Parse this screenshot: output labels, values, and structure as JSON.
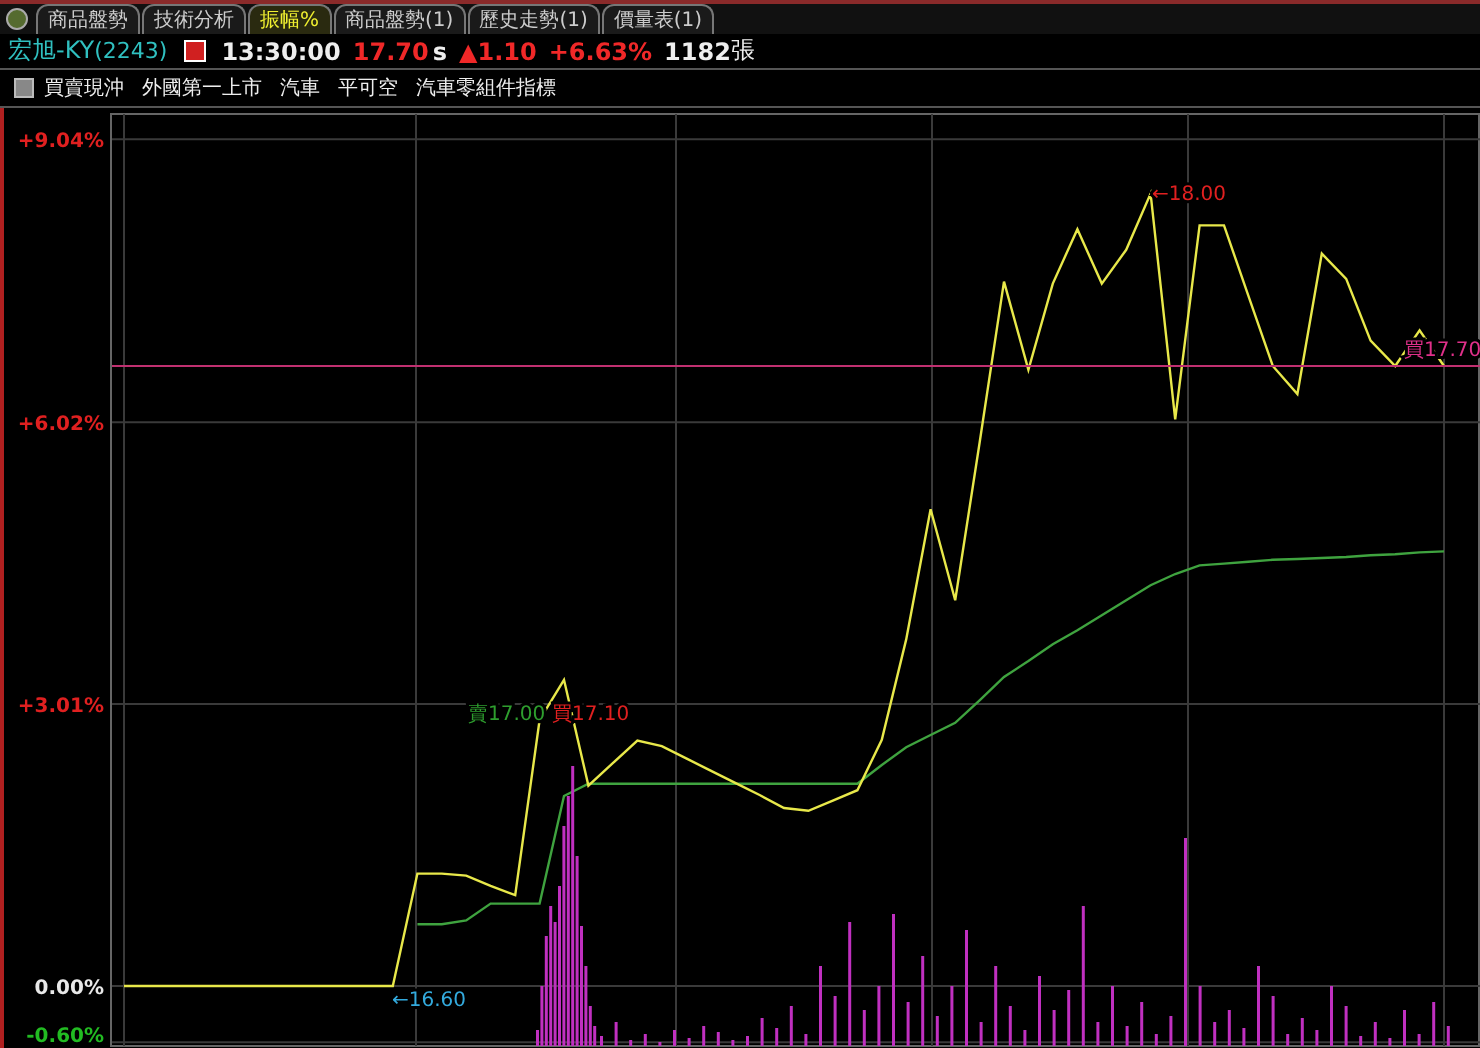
{
  "tabs": [
    {
      "label": "商品盤勢",
      "selected": false
    },
    {
      "label": "技術分析",
      "selected": false
    },
    {
      "label": "振幅%",
      "selected": true
    },
    {
      "label": "商品盤勢(1)",
      "selected": false
    },
    {
      "label": "歷史走勢(1)",
      "selected": false
    },
    {
      "label": "價量表(1)",
      "selected": false
    }
  ],
  "quote": {
    "name": "宏旭-KY",
    "code": "(2243)",
    "time": "13:30:00",
    "price": "17.70",
    "price_flag": "s",
    "change": "▲1.10",
    "change_pct": "+6.63%",
    "volume": "1182",
    "volume_unit": "張"
  },
  "tags": [
    "買賣現沖",
    "外國第一上市",
    "汽車",
    "平可空",
    "汽車零組件指標"
  ],
  "chart": {
    "chart_data": {
      "type": "line",
      "ylim": [
        -0.64,
        9.31
      ],
      "grid": true,
      "categories": [
        null,
        null,
        null,
        null,
        null,
        null,
        null,
        null,
        null,
        null,
        null,
        null,
        null,
        null,
        null,
        null,
        null,
        null,
        null,
        null,
        null,
        null,
        null,
        null,
        null,
        null,
        null,
        null,
        null,
        null,
        null,
        null,
        null,
        null,
        null,
        null,
        null,
        null,
        null,
        null,
        null,
        null,
        null,
        null,
        null,
        null,
        null,
        null,
        null,
        null,
        null,
        null,
        null,
        null,
        null
      ],
      "yticks": [
        {
          "value": 9.04,
          "label": "+9.04%"
        },
        {
          "value": 6.02,
          "label": "+6.02%"
        },
        {
          "value": 3.01,
          "label": "+3.01%"
        },
        {
          "value": 0,
          "label": "0.00%"
        },
        {
          "value": -0.6,
          "label": "-0.60%"
        }
      ],
      "series": [
        {
          "color": "#e8e84a",
          "values": [
            0,
            0,
            0,
            0,
            0,
            0,
            0,
            0,
            0,
            0,
            0,
            0,
            1.2,
            1.2,
            1.18,
            1.07,
            0.97,
            2.84,
            3.27,
            2.14,
            2.38,
            2.62,
            2.56,
            2.43,
            2.3,
            2.17,
            2.04,
            1.9,
            1.87,
            1.98,
            2.09,
            2.63,
            3.7,
            5.09,
            4.12,
            5.8,
            7.52,
            6.58,
            7.5,
            8.08,
            7.5,
            7.86,
            8.46,
            6.05,
            8.12,
            8.12,
            7.37,
            6.62,
            6.32,
            7.82,
            7.55,
            6.89,
            6.62,
            7.0,
            6.62
          ]
        },
        {
          "color": "#3fa33f",
          "values": [
            null,
            null,
            null,
            null,
            null,
            null,
            null,
            null,
            null,
            null,
            null,
            null,
            0.66,
            0.66,
            0.7,
            0.88,
            0.88,
            0.88,
            2.03,
            2.16,
            2.16,
            2.16,
            2.16,
            2.16,
            2.16,
            2.16,
            2.16,
            2.16,
            2.16,
            2.16,
            2.16,
            2.36,
            2.55,
            2.68,
            2.81,
            3.05,
            3.3,
            3.47,
            3.65,
            3.8,
            3.96,
            4.12,
            4.28,
            4.4,
            4.49,
            4.51,
            4.53,
            4.55,
            4.56,
            4.57,
            4.58,
            4.6,
            4.61,
            4.63,
            4.64
          ]
        }
      ]
    },
    "price_labels": [
      {
        "text": "←18.00",
        "color": "#e02020"
      },
      {
        "text": "←16.60",
        "color": "#33aadd"
      },
      {
        "text": "賣17.00",
        "color": "#2e9e2e"
      },
      {
        "text": "買17.10",
        "color": "#e02020"
      },
      {
        "text": "買17.70",
        "color": "#e0308a"
      }
    ]
  }
}
